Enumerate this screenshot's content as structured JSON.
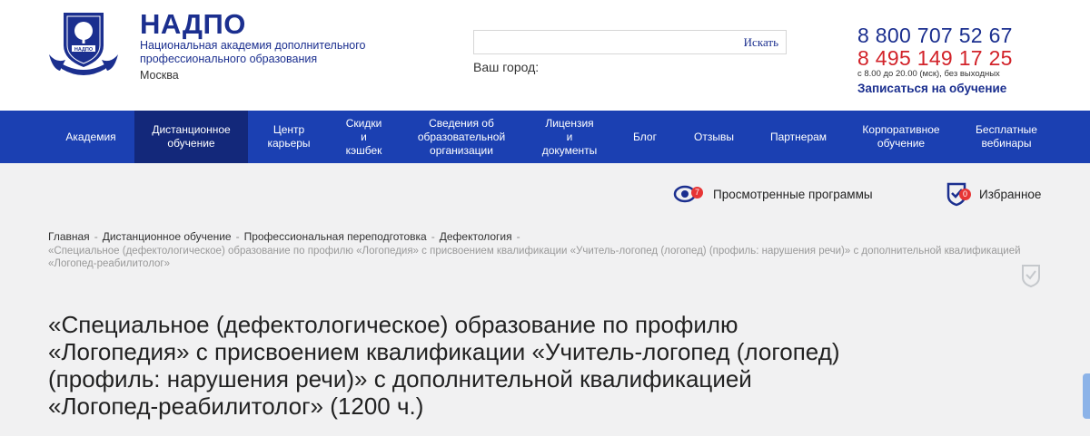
{
  "brand": {
    "name": "НАДПО",
    "description": "Национальная академия дополнительного профессионального образования",
    "city": "Москва",
    "colors": {
      "primary": "#1b2f8f",
      "nav": "#1b40b2",
      "nav_active": "#13287a",
      "accent_red": "#d2232a"
    }
  },
  "search": {
    "placeholder": "",
    "button_label": "Искать"
  },
  "city_selector": {
    "label": "Ваш город:"
  },
  "contacts": {
    "phone_primary": "8 800 707 52 67",
    "phone_secondary": "8 495 149 17 25",
    "hours": "с 8.00 до 20.00 (мск), без выходных",
    "enroll_label": "Записаться на обучение"
  },
  "nav": {
    "items": [
      {
        "label": "Академия"
      },
      {
        "label": "Дистанционное\nобучение",
        "active": true
      },
      {
        "label": "Центр\nкарьеры"
      },
      {
        "label": "Скидки\nи\nкэшбек"
      },
      {
        "label": "Сведения об\nобразовательной\nорганизации"
      },
      {
        "label": "Лицензия\nи\nдокументы"
      },
      {
        "label": "Блог"
      },
      {
        "label": "Отзывы"
      },
      {
        "label": "Партнерам"
      },
      {
        "label": "Корпоративное\nобучение"
      },
      {
        "label": "Бесплатные\nвебинары"
      }
    ]
  },
  "utility": {
    "viewed": {
      "label": "Просмотренные программы",
      "count": "7",
      "icon": "eye-icon"
    },
    "favorites": {
      "label": "Избранное",
      "count": "0",
      "icon": "shield-check-icon"
    }
  },
  "breadcrumbs": {
    "items": [
      "Главная",
      "Дистанционное обучение",
      "Профессиональная переподготовка",
      "Дефектология"
    ],
    "current": "«Специальное (дефектологическое) образование по профилю «Логопедия» с присвоением квалификации «Учитель-логопед (логопед) (профиль: нарушения речи)» с дополнительной квалификацией «Логопед-реабилитолог»"
  },
  "page": {
    "title": "«Специальное (дефектологическое) образование по профилю «Логопедия» с присвоением квалификации «Учитель-логопед (логопед) (профиль: нарушения речи)» с дополнительной квалификацией «Логопед-реабилитолог» (1200 ч.)"
  }
}
